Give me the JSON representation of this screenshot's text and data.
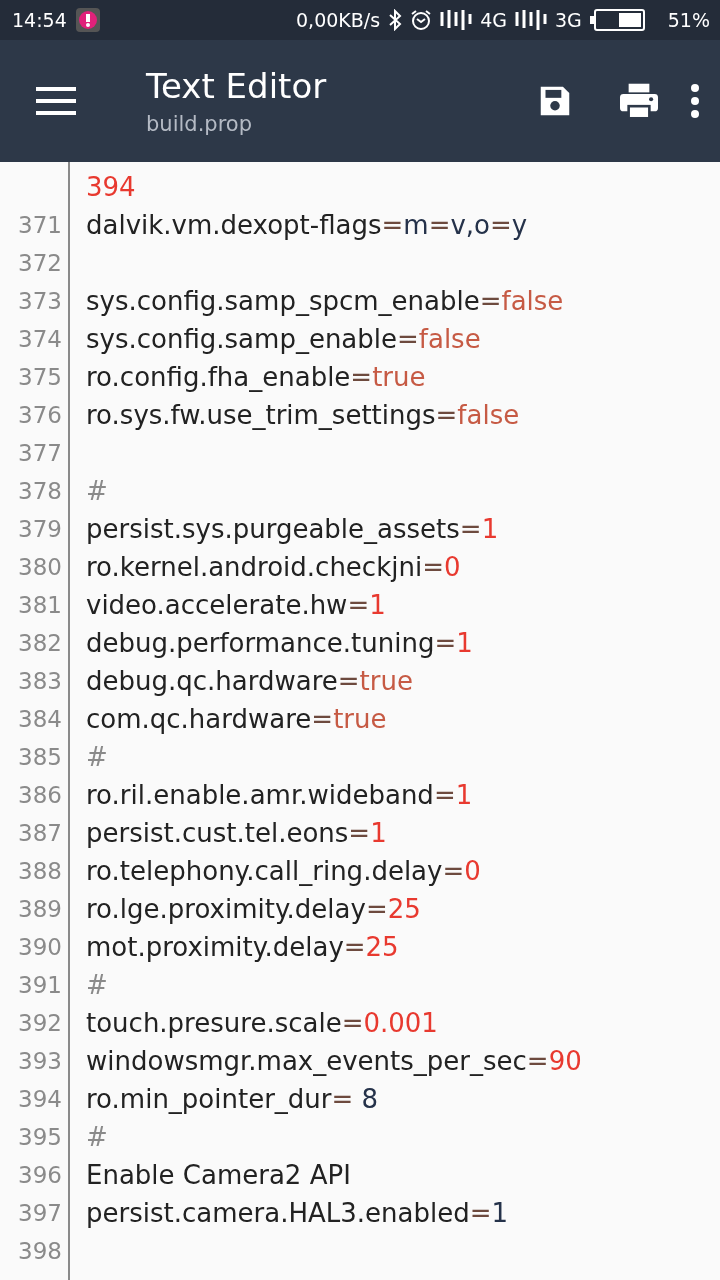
{
  "status_bar": {
    "time": "14:54",
    "speed": "0,00KB/s",
    "network_1": "4G",
    "network_2": "3G",
    "battery": "51%"
  },
  "app_bar": {
    "title": "Text Editor",
    "subtitle": "build.prop"
  },
  "lines": [
    {
      "segments": [
        {
          "kind": "number",
          "text": "394"
        }
      ]
    },
    {
      "number": "371",
      "segments": [
        {
          "kind": "key",
          "text": "dalvik.vm.dexopt-flags"
        },
        {
          "kind": "eq",
          "text": "="
        },
        {
          "kind": "plain",
          "text": "m"
        },
        {
          "kind": "eq",
          "text": "="
        },
        {
          "kind": "plain",
          "text": "v,o"
        },
        {
          "kind": "eq",
          "text": "="
        },
        {
          "kind": "plain",
          "text": "y"
        }
      ]
    },
    {
      "number": "372"
    },
    {
      "number": "373",
      "segments": [
        {
          "kind": "key",
          "text": "sys.config.samp_spcm_enable"
        },
        {
          "kind": "eq",
          "text": "="
        },
        {
          "kind": "bool",
          "text": "false"
        }
      ]
    },
    {
      "number": "374",
      "segments": [
        {
          "kind": "key",
          "text": "sys.config.samp_enable"
        },
        {
          "kind": "eq",
          "text": "="
        },
        {
          "kind": "bool",
          "text": "false"
        }
      ]
    },
    {
      "number": "375",
      "segments": [
        {
          "kind": "key",
          "text": "ro.config.fha_enable"
        },
        {
          "kind": "eq",
          "text": "="
        },
        {
          "kind": "bool",
          "text": "true"
        }
      ]
    },
    {
      "number": "376",
      "segments": [
        {
          "kind": "key",
          "text": "ro.sys.fw.use_trim_settings"
        },
        {
          "kind": "eq",
          "text": "="
        },
        {
          "kind": "bool",
          "text": "false"
        }
      ]
    },
    {
      "number": "377"
    },
    {
      "number": "378",
      "segments": [
        {
          "kind": "comment",
          "text": "#"
        }
      ]
    },
    {
      "number": "379",
      "segments": [
        {
          "kind": "key",
          "text": "persist.sys.purgeable_assets"
        },
        {
          "kind": "eq",
          "text": "="
        },
        {
          "kind": "number",
          "text": "1"
        }
      ]
    },
    {
      "number": "380",
      "segments": [
        {
          "kind": "key",
          "text": "ro.kernel.android.checkjni"
        },
        {
          "kind": "eq",
          "text": "="
        },
        {
          "kind": "number",
          "text": "0"
        }
      ]
    },
    {
      "number": "381",
      "segments": [
        {
          "kind": "key",
          "text": "video.accelerate.hw"
        },
        {
          "kind": "eq",
          "text": "="
        },
        {
          "kind": "number",
          "text": "1"
        }
      ]
    },
    {
      "number": "382",
      "segments": [
        {
          "kind": "key",
          "text": "debug.performance.tuning"
        },
        {
          "kind": "eq",
          "text": "="
        },
        {
          "kind": "number",
          "text": "1"
        }
      ]
    },
    {
      "number": "383",
      "segments": [
        {
          "kind": "key",
          "text": "debug.qc.hardware"
        },
        {
          "kind": "eq",
          "text": "="
        },
        {
          "kind": "bool",
          "text": "true"
        }
      ]
    },
    {
      "number": "384",
      "segments": [
        {
          "kind": "key",
          "text": "com.qc.hardware"
        },
        {
          "kind": "eq",
          "text": "="
        },
        {
          "kind": "bool",
          "text": "true"
        }
      ]
    },
    {
      "number": "385",
      "segments": [
        {
          "kind": "comment",
          "text": "#"
        }
      ]
    },
    {
      "number": "386",
      "segments": [
        {
          "kind": "key",
          "text": "ro.ril.enable.amr.wideband"
        },
        {
          "kind": "eq",
          "text": "="
        },
        {
          "kind": "number",
          "text": "1"
        }
      ]
    },
    {
      "number": "387",
      "segments": [
        {
          "kind": "key",
          "text": "persist.cust.tel.eons"
        },
        {
          "kind": "eq",
          "text": "="
        },
        {
          "kind": "number",
          "text": "1"
        }
      ]
    },
    {
      "number": "388",
      "segments": [
        {
          "kind": "key",
          "text": "ro.telephony.call_ring.delay"
        },
        {
          "kind": "eq",
          "text": "="
        },
        {
          "kind": "number",
          "text": "0"
        }
      ]
    },
    {
      "number": "389",
      "segments": [
        {
          "kind": "key",
          "text": "ro.lge.proximity.delay"
        },
        {
          "kind": "eq",
          "text": "="
        },
        {
          "kind": "number",
          "text": "25"
        }
      ]
    },
    {
      "number": "390",
      "segments": [
        {
          "kind": "key",
          "text": "mot.proximity.delay"
        },
        {
          "kind": "eq",
          "text": "="
        },
        {
          "kind": "number",
          "text": "25"
        }
      ]
    },
    {
      "number": "391",
      "segments": [
        {
          "kind": "comment",
          "text": "#"
        }
      ]
    },
    {
      "number": "392",
      "segments": [
        {
          "kind": "key",
          "text": "touch.presure.scale"
        },
        {
          "kind": "eq",
          "text": "="
        },
        {
          "kind": "number",
          "text": "0.001"
        }
      ]
    },
    {
      "number": "393",
      "segments": [
        {
          "kind": "key",
          "text": "windowsmgr.max_events_per_sec"
        },
        {
          "kind": "eq",
          "text": "="
        },
        {
          "kind": "number",
          "text": "90"
        }
      ]
    },
    {
      "number": "394",
      "segments": [
        {
          "kind": "key",
          "text": "ro.min_pointer_dur"
        },
        {
          "kind": "eq",
          "text": "="
        },
        {
          "kind": "plain",
          "text": " 8"
        }
      ]
    },
    {
      "number": "395",
      "segments": [
        {
          "kind": "comment",
          "text": "#"
        }
      ]
    },
    {
      "number": "396",
      "segments": [
        {
          "kind": "key",
          "text": "Enable Camera2 API"
        }
      ]
    },
    {
      "number": "397",
      "segments": [
        {
          "kind": "key",
          "text": "persist.camera.HAL3.enabled"
        },
        {
          "kind": "eq",
          "text": "="
        },
        {
          "kind": "plain",
          "text": "1"
        }
      ]
    },
    {
      "number": "398"
    }
  ]
}
